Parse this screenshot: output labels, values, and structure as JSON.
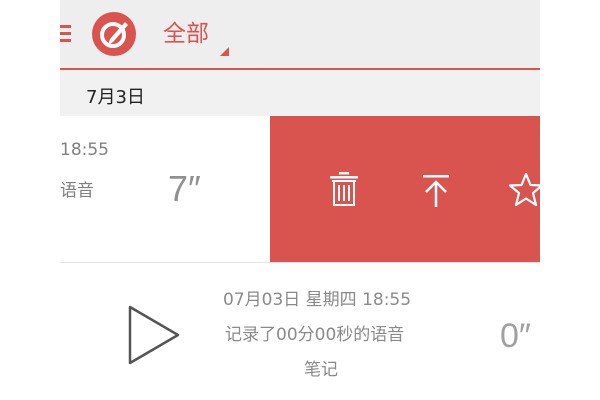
{
  "toolbar": {
    "filter_label": "全部"
  },
  "colors": {
    "accent": "#d9534f",
    "toolbar_bg": "#eeeeee",
    "date_header_bg": "#f1f1f1"
  },
  "icons": {
    "menu": "hamburger-menu-icon",
    "logo": "app-logo-icon",
    "delete": "trash-icon",
    "pin": "pin-to-top-icon",
    "favorite": "star-icon",
    "play": "play-icon"
  },
  "date_group": {
    "label": "7月3日"
  },
  "notes": [
    {
      "time": "18:55",
      "description": "语音",
      "duration": "7″",
      "actions": [
        "delete",
        "pin-to-top",
        "favorite"
      ]
    },
    {
      "datetime": "07月03日  星期四  18:55",
      "description": "记录了00分00秒的语音",
      "type": "笔记",
      "duration": "0″"
    }
  ]
}
